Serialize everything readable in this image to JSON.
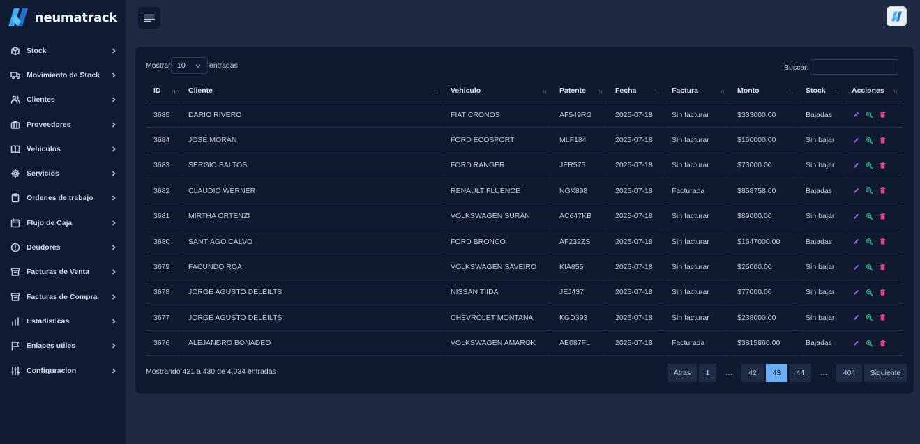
{
  "brand": {
    "name": "neumatrack"
  },
  "sidebar": {
    "items": [
      {
        "label": "Stock",
        "icon": "box-icon"
      },
      {
        "label": "Movimiento de Stock",
        "icon": "truck-icon"
      },
      {
        "label": "Clientes",
        "icon": "users-icon"
      },
      {
        "label": "Proveedores",
        "icon": "briefcase-icon"
      },
      {
        "label": "Vehiculos",
        "icon": "book-icon"
      },
      {
        "label": "Servicios",
        "icon": "gear-icon"
      },
      {
        "label": "Ordenes de trabajo",
        "icon": "clipboard-icon"
      },
      {
        "label": "Flujo de Caja",
        "icon": "calendar-icon"
      },
      {
        "label": "Deudores",
        "icon": "alert-circle-icon"
      },
      {
        "label": "Facturas de Venta",
        "icon": "archive-icon"
      },
      {
        "label": "Facturas de Compra",
        "icon": "archive-icon"
      },
      {
        "label": "Estadisticas",
        "icon": "bar-chart-icon"
      },
      {
        "label": "Enlaces utiles",
        "icon": "flag-icon"
      },
      {
        "label": "Configuracion",
        "icon": "sliders-icon"
      }
    ]
  },
  "table_controls": {
    "show_label": "Mostrar",
    "page_size": "10",
    "entries_label": "entradas",
    "search_label": "Buscar:",
    "search_value": ""
  },
  "table": {
    "columns": [
      "ID",
      "Cliente",
      "Vehiculo",
      "Patente",
      "Fecha",
      "Factura",
      "Monto",
      "Stock",
      "Acciones"
    ],
    "rows": [
      [
        "3685",
        "DARIO RIVERO",
        "FIAT CRONOS",
        "AF549RG",
        "2025-07-18",
        "Sin facturar",
        "$333000.00",
        "Bajadas"
      ],
      [
        "3684",
        "JOSE MORAN",
        "FORD ECOSPORT",
        "MLF184",
        "2025-07-18",
        "Sin facturar",
        "$150000.00",
        "Sin bajar"
      ],
      [
        "3683",
        "SERGIO SALTOS",
        "FORD RANGER",
        "JER575",
        "2025-07-18",
        "Sin facturar",
        "$73000.00",
        "Sin bajar"
      ],
      [
        "3682",
        "CLAUDIO WERNER",
        "RENAULT FLUENCE",
        "NGX898",
        "2025-07-18",
        "Facturada",
        "$858758.00",
        "Bajadas"
      ],
      [
        "3681",
        "MIRTHA ORTENZI",
        "VOLKSWAGEN SURAN",
        "AC647KB",
        "2025-07-18",
        "Sin facturar",
        "$89000.00",
        "Sin bajar"
      ],
      [
        "3680",
        "SANTIAGO CALVO",
        "FORD BRONCO",
        "AF232ZS",
        "2025-07-18",
        "Sin facturar",
        "$1647000.00",
        "Bajadas"
      ],
      [
        "3679",
        "FACUNDO ROA",
        "VOLKSWAGEN SAVEIRO",
        "KIA855",
        "2025-07-18",
        "Sin facturar",
        "$25000.00",
        "Sin bajar"
      ],
      [
        "3678",
        "JORGE AGUSTO DELEILTS",
        "NISSAN TIIDA",
        "JEJ437",
        "2025-07-18",
        "Sin facturar",
        "$77000.00",
        "Sin bajar"
      ],
      [
        "3677",
        "JORGE AGUSTO DELEILTS",
        "CHEVROLET MONTANA",
        "KGD393",
        "2025-07-18",
        "Sin facturar",
        "$238000.00",
        "Sin bajar"
      ],
      [
        "3676",
        "ALEJANDRO BONADEO",
        "VOLKSWAGEN AMAROK",
        "AE087FL",
        "2025-07-18",
        "Facturada",
        "$3815860.00",
        "Bajadas"
      ]
    ]
  },
  "footer": {
    "info": "Mostrando 421 a 430 de 4,034 entradas"
  },
  "pagination": {
    "prev": "Atras",
    "next": "Siguiente",
    "pages": [
      {
        "label": "1",
        "active": false
      },
      {
        "label": "…",
        "dots": true
      },
      {
        "label": "42",
        "active": false
      },
      {
        "label": "43",
        "active": true
      },
      {
        "label": "44",
        "active": false
      },
      {
        "label": "…",
        "dots": true
      },
      {
        "label": "404",
        "active": false
      }
    ]
  },
  "colors": {
    "sidebar_bg": "#0f1a33",
    "page_bg": "#1e2a44",
    "card_bg": "#0f1a31",
    "accent": "#6aaef3",
    "edit_icon": "#a65cf0",
    "view_icon": "#2bbd8e",
    "delete_icon": "#e83e8c"
  }
}
